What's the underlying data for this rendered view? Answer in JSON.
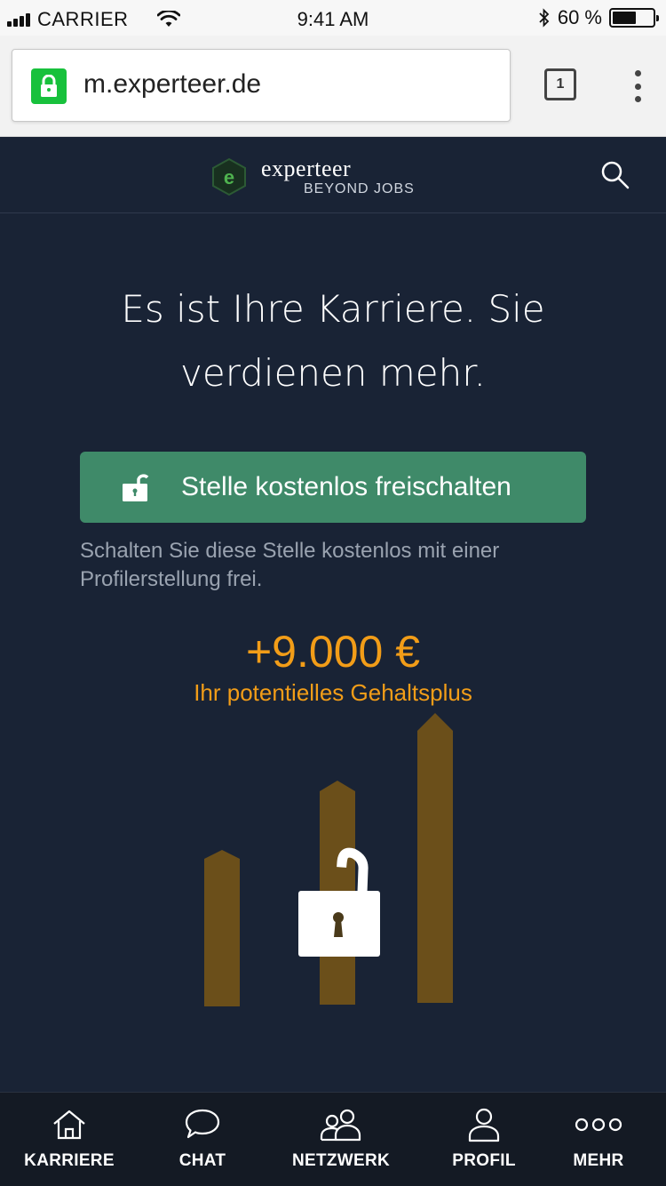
{
  "status_bar": {
    "carrier": "CARRIER",
    "time": "9:41 AM",
    "battery": "60 %",
    "battery_level": 0.6
  },
  "browser": {
    "url": "m.experteer.de",
    "tab_count": "1",
    "lock_color": "#18c13c"
  },
  "header": {
    "brand_name": "experteer",
    "brand_tagline": "BEYOND JOBS",
    "logo_icon": "experteer-logo",
    "search_icon": "search-icon"
  },
  "hero": {
    "headline_line1": "Es ist Ihre Karriere. Sie",
    "headline_line2": "verdienen mehr.",
    "cta_label": "Stelle kostenlos freischalten",
    "cta_color": "#3f8a69",
    "cta_note": "Schalten Sie diese Stelle kostenlos mit einer Profilerstellung frei.",
    "salary_amount": "+9.000 €",
    "salary_label": "Ihr potentielles Gehaltsplus",
    "accent_color": "#f29d18"
  },
  "bottom_nav": [
    {
      "label": "KARRIERE",
      "icon": "home-icon"
    },
    {
      "label": "CHAT",
      "icon": "chat-bubble-icon"
    },
    {
      "label": "NETZWERK",
      "icon": "people-icon"
    },
    {
      "label": "PROFIL",
      "icon": "user-icon"
    },
    {
      "label": "MEHR",
      "icon": "more-dots-icon"
    }
  ]
}
